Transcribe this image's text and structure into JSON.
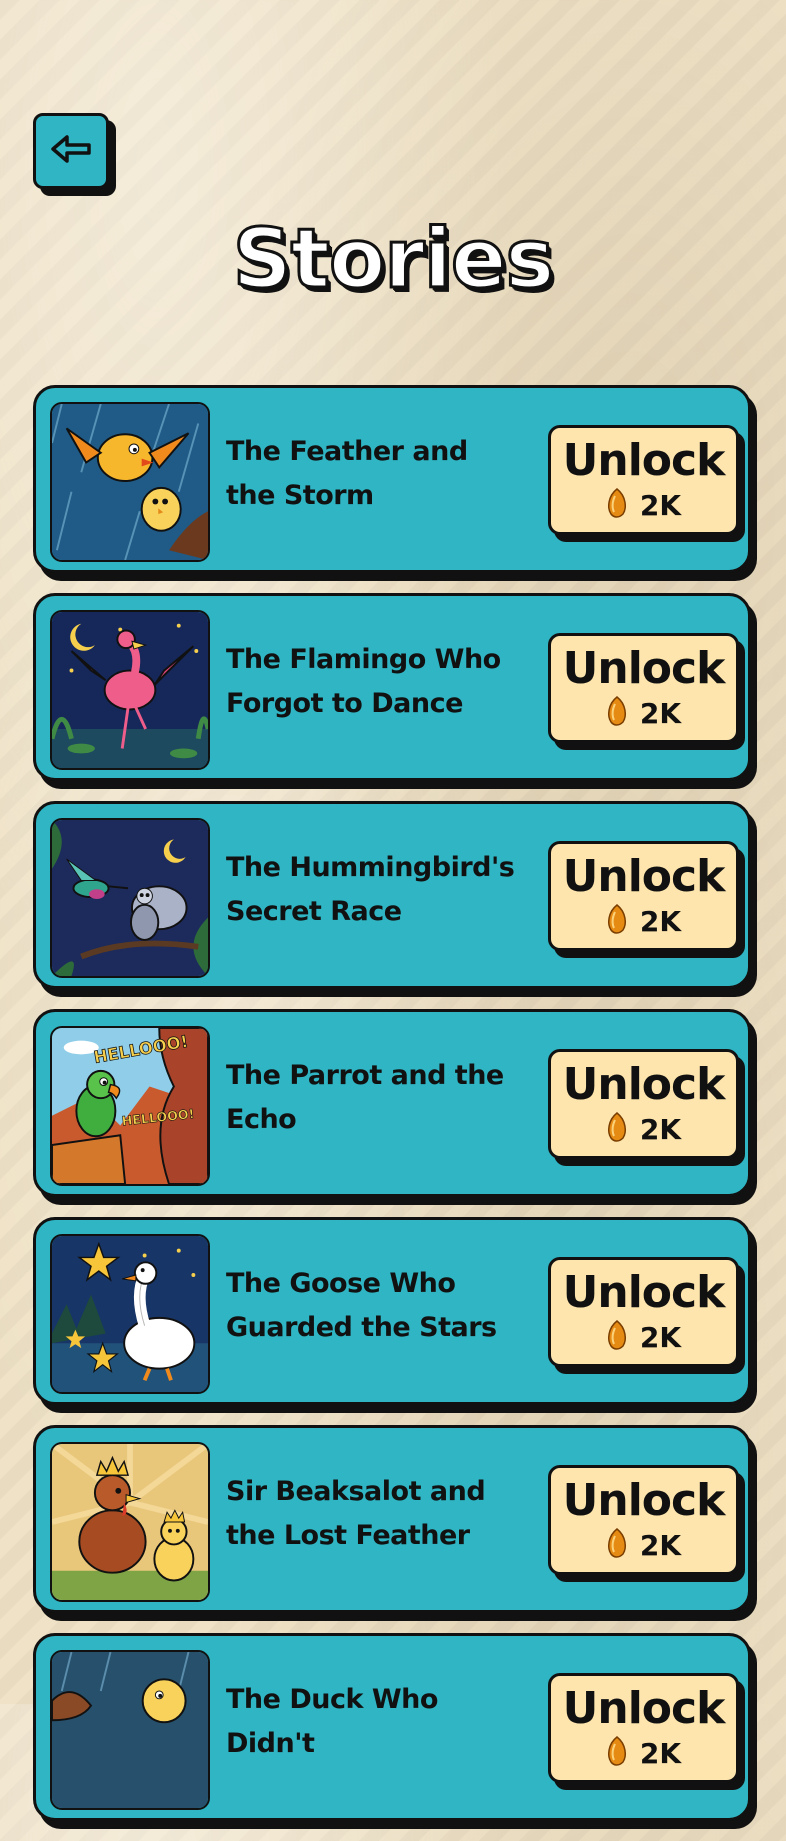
{
  "header": {
    "title": "Stories",
    "back_icon": "back-arrow-icon"
  },
  "colors": {
    "card": "#2fb5c3",
    "unlock_button": "#fde5ad",
    "outline": "#111111",
    "coin": "#e58a12"
  },
  "stories": [
    {
      "title": "The Feather and the Storm",
      "button_label": "Unlock",
      "price": "2K",
      "price_icon": "seed-coin-icon",
      "image": "storm-chicks-image"
    },
    {
      "title": "The Flamingo Who Forgot to Dance",
      "button_label": "Unlock",
      "price": "2K",
      "price_icon": "seed-coin-icon",
      "image": "flamingo-night-image"
    },
    {
      "title": "The Hummingbird's Secret Race",
      "button_label": "Unlock",
      "price": "2K",
      "price_icon": "seed-coin-icon",
      "image": "hummingbird-moth-image"
    },
    {
      "title": "The Parrot and the Echo",
      "button_label": "Unlock",
      "price": "2K",
      "price_icon": "seed-coin-icon",
      "image": "parrot-canyon-image",
      "image_text": [
        "HELLOOO!",
        "HELLOOO!"
      ]
    },
    {
      "title": "The Goose Who Guarded the Stars",
      "button_label": "Unlock",
      "price": "2K",
      "price_icon": "seed-coin-icon",
      "image": "goose-stars-image"
    },
    {
      "title": "Sir Beaksalot and the Lost Feather",
      "button_label": "Unlock",
      "price": "2K",
      "price_icon": "seed-coin-icon",
      "image": "rooster-king-image"
    },
    {
      "title": "The Duck Who Didn't",
      "button_label": "Unlock",
      "price": "2K",
      "price_icon": "seed-coin-icon",
      "image": "duck-rain-image"
    }
  ]
}
